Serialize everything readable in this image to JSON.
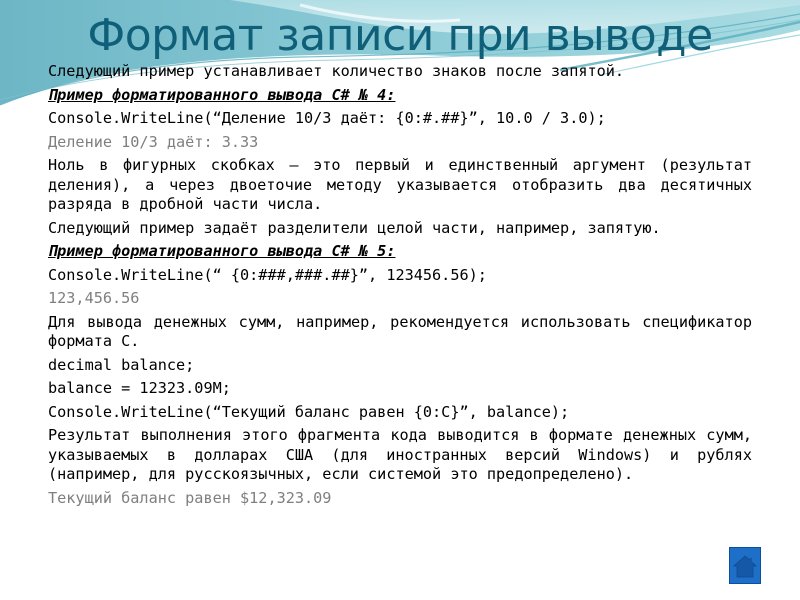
{
  "slide": {
    "title": "Формат записи при выводе",
    "paragraphs": [
      {
        "type": "text",
        "text": "Следующий пример устанавливает количество знаков после запятой."
      },
      {
        "type": "heading",
        "text": "Пример форматированного вывода C# № 4:"
      },
      {
        "type": "code",
        "text": "Console.WriteLine(“Деление 10/3 даёт: {0:#.##}”, 10.0 / 3.0);"
      },
      {
        "type": "output",
        "text": "Деление 10/3 даёт: 3.33"
      },
      {
        "type": "text",
        "text": "Ноль в фигурных скобках – это первый и единственный аргумент (результат деления), а через двоеточие методу указывается отобразить два десятичных разряда в дробной части числа."
      },
      {
        "type": "text",
        "text": "Следующий пример задаёт разделители целой части, например, запятую."
      },
      {
        "type": "heading",
        "text": "Пример форматированного вывода C# № 5:"
      },
      {
        "type": "code",
        "text": "Console.WriteLine(“ {0:###,###.##}”, 123456.56);"
      },
      {
        "type": "output",
        "text": "123,456.56"
      },
      {
        "type": "text",
        "text": "Для вывода денежных сумм, например, рекомендуется использовать спецификатор формата C."
      },
      {
        "type": "code",
        "text": "decimal balance;"
      },
      {
        "type": "code",
        "text": "balance = 12323.09M;"
      },
      {
        "type": "code",
        "text": "Console.WriteLine(“Текущий баланс равен {0:C}”, balance);"
      },
      {
        "type": "text",
        "text": "Результат выполнения этого фрагмента кода выводится в формате денежных сумм, указываемых в долларах США (для иностранных версий Windows) и рублях (например, для русскоязычных, если системой это предопределено)."
      },
      {
        "type": "output",
        "text": "Текущий баланс равен $12,323.09"
      }
    ]
  },
  "nav": {
    "home_icon": "home-icon"
  },
  "colors": {
    "title": "#0f5f79",
    "output_text": "#7f7f7f",
    "home_button": "#1e6fc8",
    "header_wave": "#7fc3cf"
  }
}
